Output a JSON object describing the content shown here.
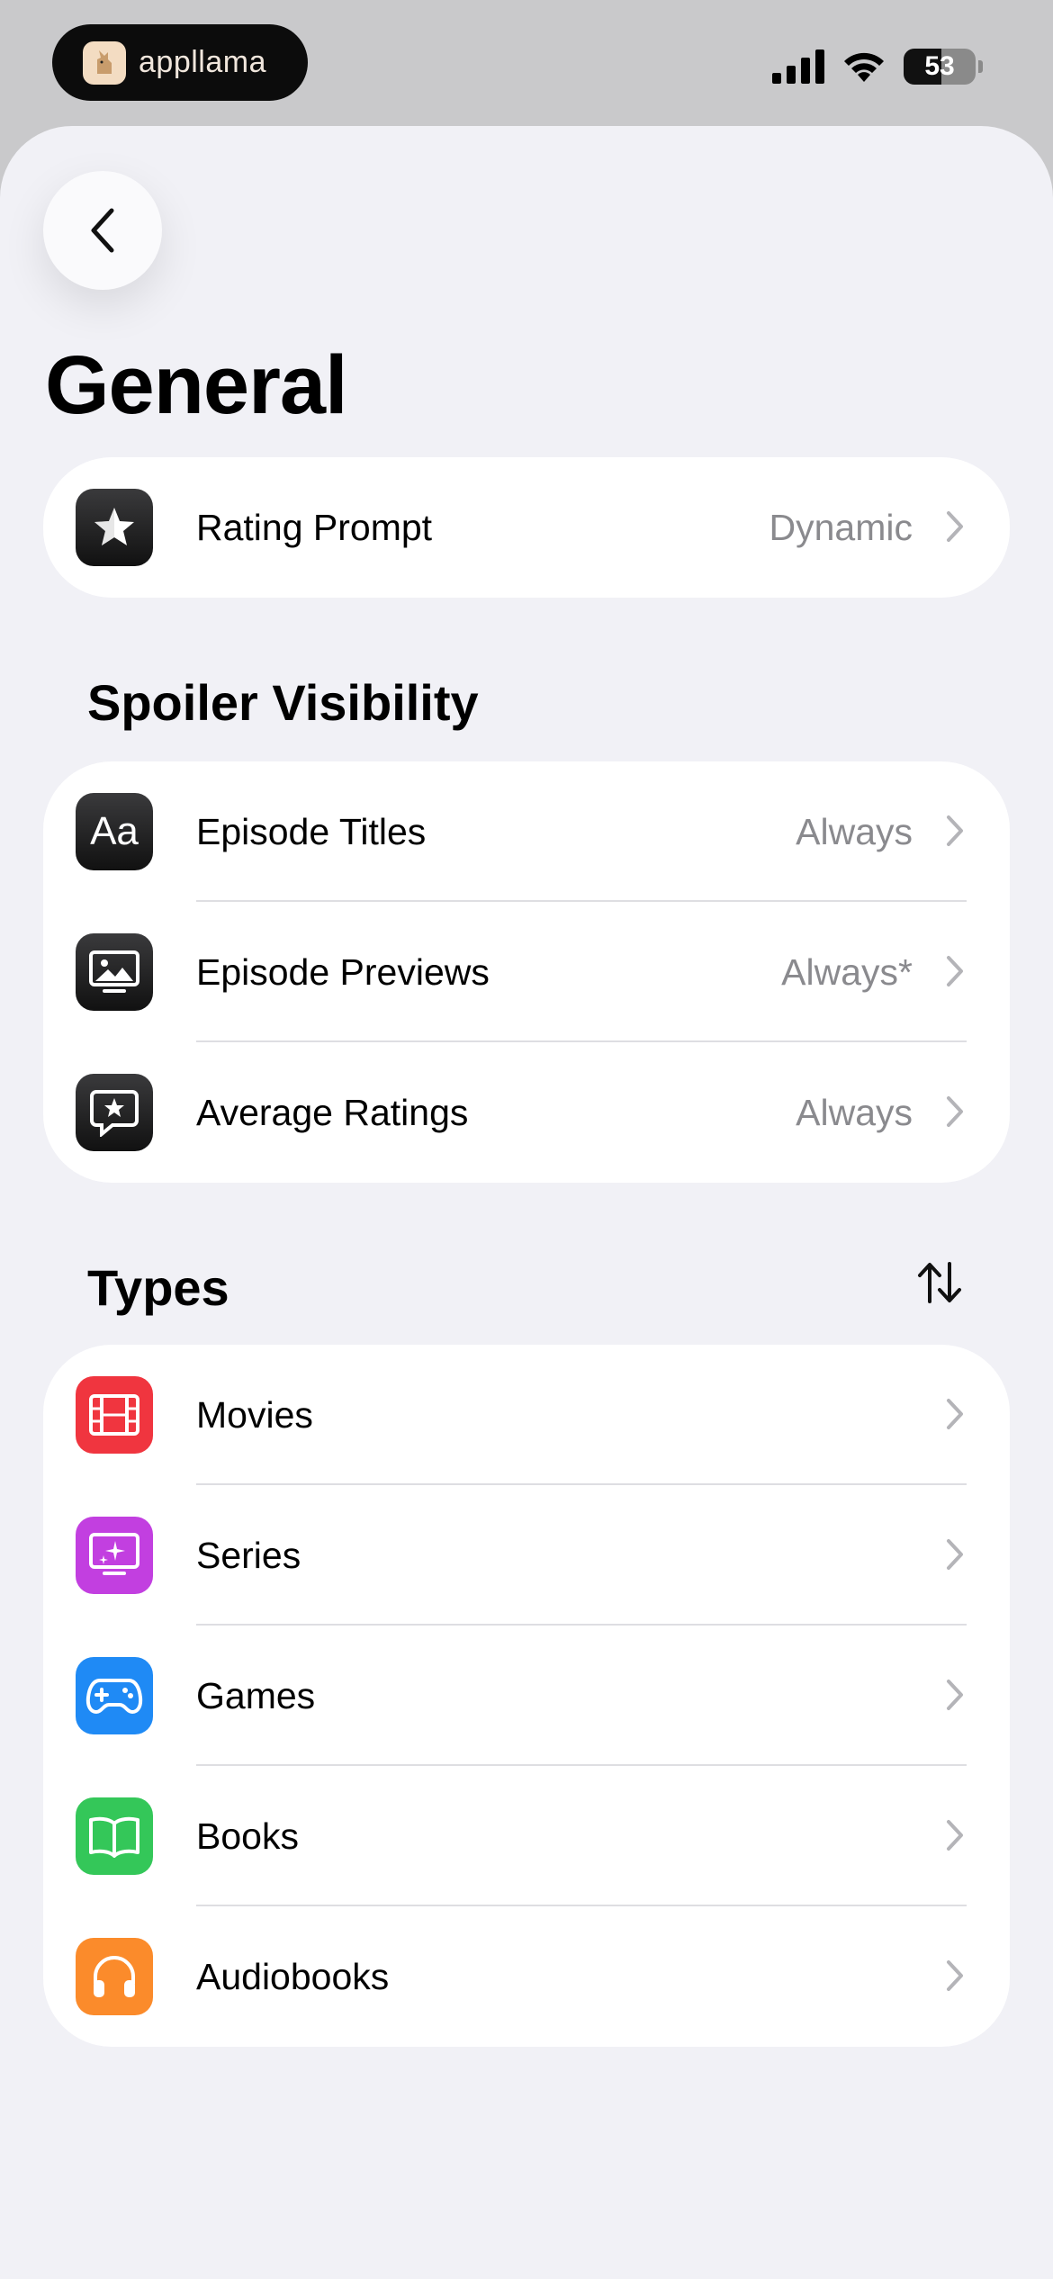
{
  "status_bar": {
    "brand": "appllama",
    "battery": "53",
    "battery_level": 0.53
  },
  "page": {
    "title": "General"
  },
  "general_card": [
    {
      "label": "Rating Prompt",
      "value": "Dynamic",
      "icon": "star-icon"
    }
  ],
  "spoiler": {
    "header": "Spoiler Visibility",
    "items": [
      {
        "label": "Episode Titles",
        "value": "Always",
        "icon": "text-format-icon"
      },
      {
        "label": "Episode Previews",
        "value": "Always*",
        "icon": "photo-tv-icon"
      },
      {
        "label": "Average Ratings",
        "value": "Always",
        "icon": "rating-bubble-icon"
      }
    ]
  },
  "types": {
    "header": "Types",
    "items": [
      {
        "label": "Movies",
        "icon": "film-icon",
        "color": "#f0353f"
      },
      {
        "label": "Series",
        "icon": "tv-sparkle-icon",
        "color": "#c23fe0"
      },
      {
        "label": "Games",
        "icon": "gamepad-icon",
        "color": "#1f8af5"
      },
      {
        "label": "Books",
        "icon": "book-icon",
        "color": "#34c759"
      },
      {
        "label": "Audiobooks",
        "icon": "headphones-icon",
        "color": "#fb8b2b"
      }
    ]
  }
}
